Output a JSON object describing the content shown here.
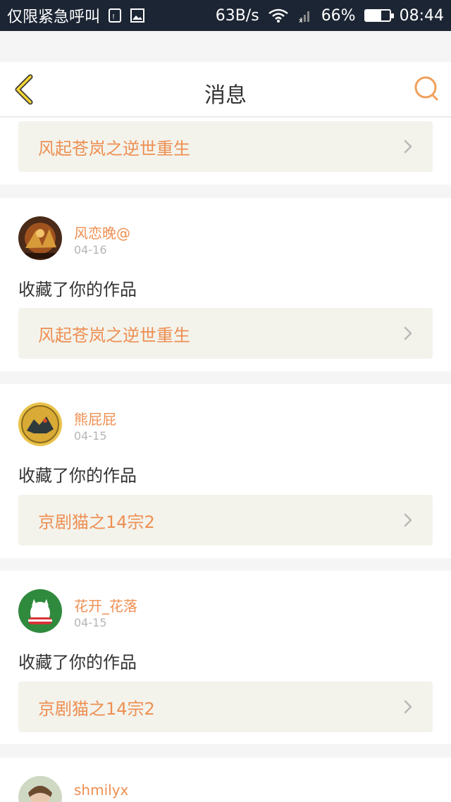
{
  "status_bar": {
    "carrier": "仅限紧急呼叫",
    "speed": "63B/s",
    "battery": "66%",
    "battery_level": 0.66,
    "time": "08:44"
  },
  "header": {
    "title": "消息",
    "accent_color": "#f0a05a"
  },
  "messages": [
    {
      "work": "风起苍岚之逆世重生"
    },
    {
      "user": "风恋晚@",
      "date": "04-16",
      "action": "收藏了你的作品",
      "work": "风起苍岚之逆世重生"
    },
    {
      "user": "熊屁屁",
      "date": "04-15",
      "action": "收藏了你的作品",
      "work": "京剧猫之14宗2"
    },
    {
      "user": "花开_花落",
      "date": "04-15",
      "action": "收藏了你的作品",
      "work": "京剧猫之14宗2"
    },
    {
      "user": "shmilyx"
    }
  ]
}
